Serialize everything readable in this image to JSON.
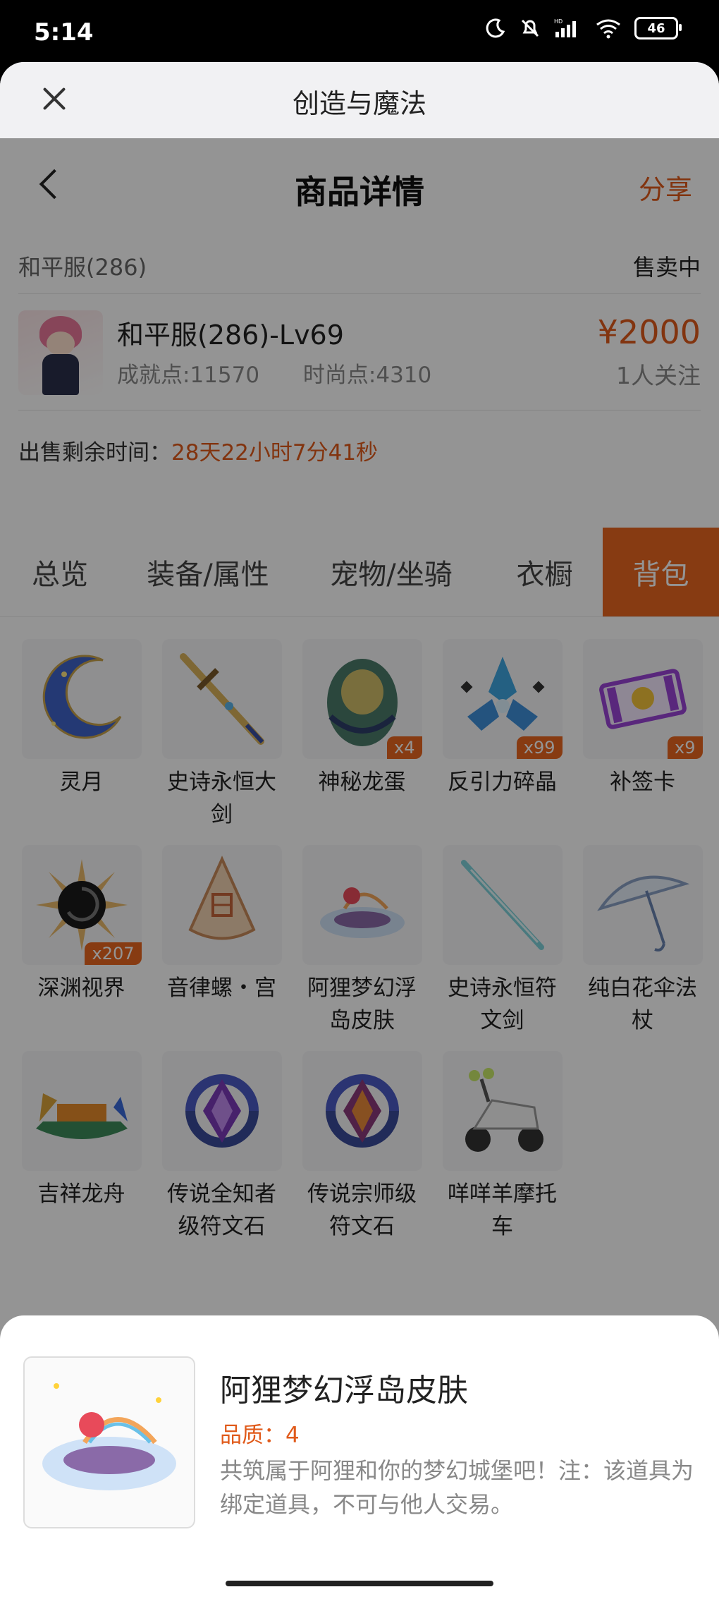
{
  "status_bar": {
    "time": "5:14",
    "battery": "46"
  },
  "sheet": {
    "title": "创造与魔法"
  },
  "nav": {
    "title": "商品详情",
    "share": "分享"
  },
  "server": {
    "name": "和平服(286)",
    "status": "售卖中"
  },
  "product": {
    "name": "和平服(286)-Lv69",
    "achievement": "成就点:11570",
    "fashion": "时尚点:4310",
    "price": "¥2000",
    "followers": "1人关注"
  },
  "remain": {
    "label": "出售剩余时间：",
    "value": "28天22小时7分41秒"
  },
  "tabs": [
    {
      "label": "总览"
    },
    {
      "label": "装备/属性"
    },
    {
      "label": "宠物/坐骑"
    },
    {
      "label": "衣橱"
    },
    {
      "label": "背包"
    }
  ],
  "active_tab": "背包",
  "items": [
    {
      "name": "灵月",
      "count": ""
    },
    {
      "name": "史诗永恒大剑",
      "count": ""
    },
    {
      "name": "神秘龙蛋",
      "count": "x4"
    },
    {
      "name": "反引力碎晶",
      "count": "x99"
    },
    {
      "name": "补签卡",
      "count": "x9"
    },
    {
      "name": "深渊视界",
      "count": "x207"
    },
    {
      "name": "音律螺・宫",
      "count": ""
    },
    {
      "name": "阿狸梦幻浮岛皮肤",
      "count": ""
    },
    {
      "name": "史诗永恒符文剑",
      "count": ""
    },
    {
      "name": "纯白花伞法杖",
      "count": ""
    },
    {
      "name": "吉祥龙舟",
      "count": ""
    },
    {
      "name": "传说全知者级符文石",
      "count": ""
    },
    {
      "name": "传说宗师级符文石",
      "count": ""
    },
    {
      "name": "咩咩羊摩托车",
      "count": ""
    }
  ],
  "popup": {
    "title": "阿狸梦幻浮岛皮肤",
    "quality": "品质：4",
    "description": "共筑属于阿狸和你的梦幻城堡吧！注：该道具为绑定道具，不可与他人交易。"
  },
  "colors": {
    "accent": "#e8661f",
    "price": "#e05a1a"
  }
}
